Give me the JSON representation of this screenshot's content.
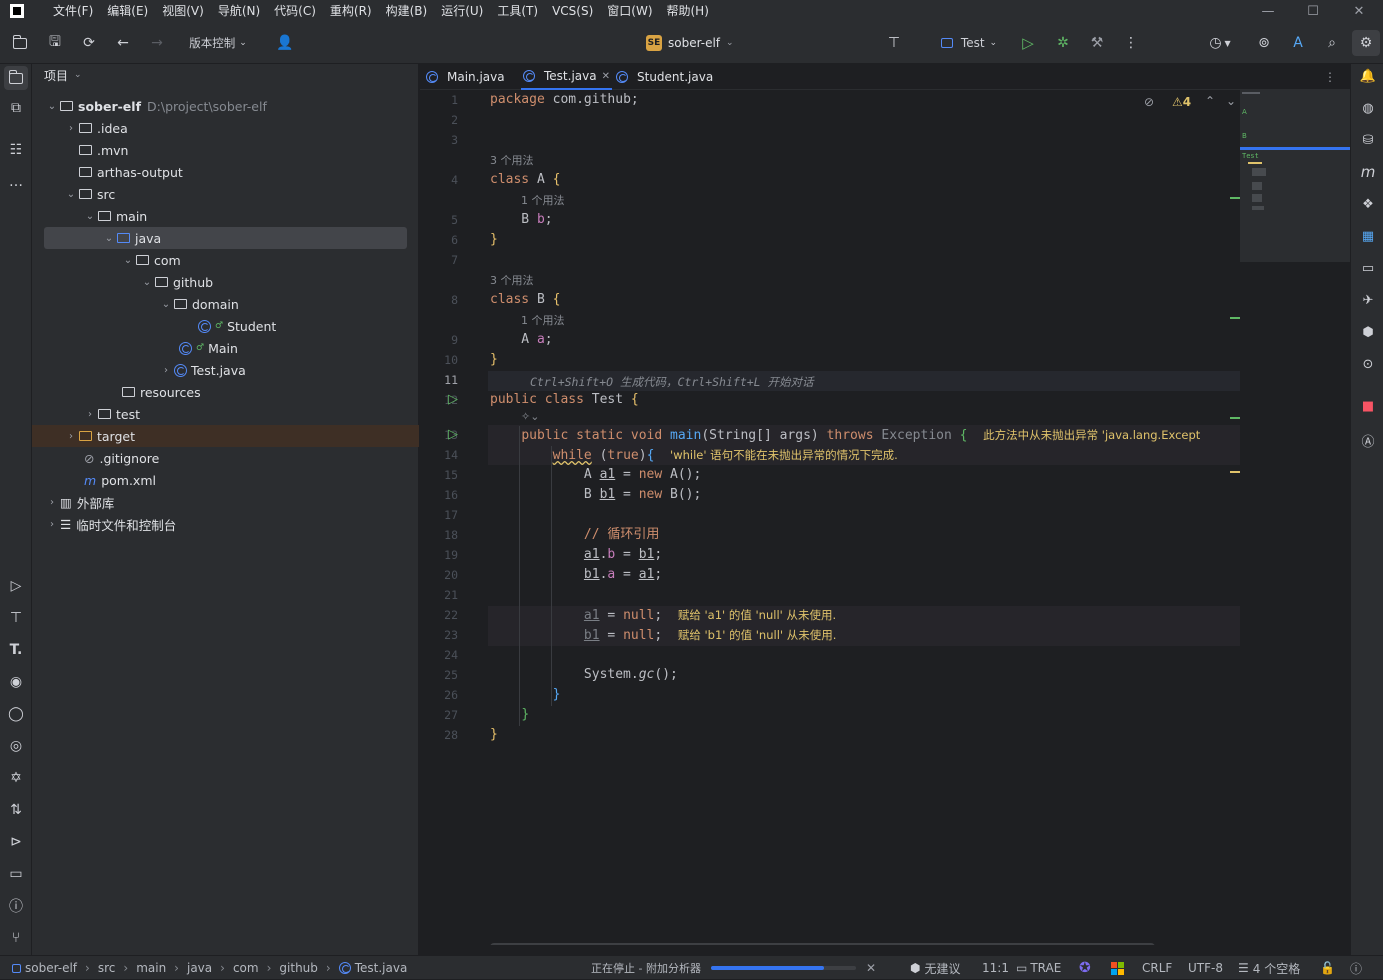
{
  "menu": [
    "文件(F)",
    "编辑(E)",
    "视图(V)",
    "导航(N)",
    "代码(C)",
    "重构(R)",
    "构建(B)",
    "运行(U)",
    "工具(T)",
    "VCS(S)",
    "窗口(W)",
    "帮助(H)"
  ],
  "toolbar": {
    "vcs_label": "版本控制",
    "project_badge": "SE",
    "project_name": "sober-elf",
    "run_config": "Test"
  },
  "project_panel": {
    "title": "项目",
    "root_name": "sober-elf",
    "root_path": "D:\\project\\sober-elf",
    "items": [
      ".idea",
      ".mvn",
      "arthas-output",
      "src",
      "main",
      "java",
      "com",
      "github",
      "domain",
      "Student",
      "Main",
      "Test.java",
      "resources",
      "test",
      "target",
      ".gitignore",
      "pom.xml",
      "外部库",
      "临时文件和控制台"
    ]
  },
  "tabs": [
    "Main.java",
    "Test.java",
    "Student.java"
  ],
  "editor": {
    "warn_count": "4",
    "usage3": "3 个用法",
    "usage1": "1 个用法",
    "hint_line11": "Ctrl+Shift+O 生成代码，Ctrl+Shift+L 开始对话",
    "lines": {
      "l1": "package com.github;",
      "l4": "class A {",
      "l5": "B b;",
      "l6": "}",
      "l8": "class B {",
      "l9": "A a;",
      "l10": "}",
      "l12": "public class Test {",
      "l13": "public static void main(String[] args) throws Exception {",
      "l13_warn": "此方法中从未抛出异常 'java.lang.Except",
      "l14": "while (true){",
      "l14_warn": "'while' 语句不能在未抛出异常的情况下完成.",
      "l15": "A a1 = new A();",
      "l16": "B b1 = new B();",
      "l18": "// 循环引用",
      "l19": "a1.b = b1;",
      "l20": "b1.a = a1;",
      "l22": "a1 = null;",
      "l22_warn": "赋给 'a1' 的值 'null' 从未使用.",
      "l23": "b1 = null;",
      "l23_warn": "赋给 'b1' 的值 'null' 从未使用.",
      "l25": "System.gc();",
      "l26": "}",
      "l27": "}",
      "l28": "}"
    }
  },
  "status": {
    "breadcrumbs": [
      "sober-elf",
      "src",
      "main",
      "java",
      "com",
      "github",
      "Test.java"
    ],
    "task": "正在停止 - 附加分析器",
    "task_progress": 0.78,
    "no_suggestion": "无建议",
    "position": "11:1",
    "trae": "TRAE",
    "line_sep": "CRLF",
    "encoding": "UTF-8",
    "indent": "4 个空格"
  },
  "colors": {
    "accent": "#3574f0",
    "keyword": "#cf8e6d",
    "function": "#56a8f5",
    "string": "#6aab73",
    "warning": "#e0c36b",
    "bg": "#1e1f22",
    "panel": "#2b2d30"
  }
}
